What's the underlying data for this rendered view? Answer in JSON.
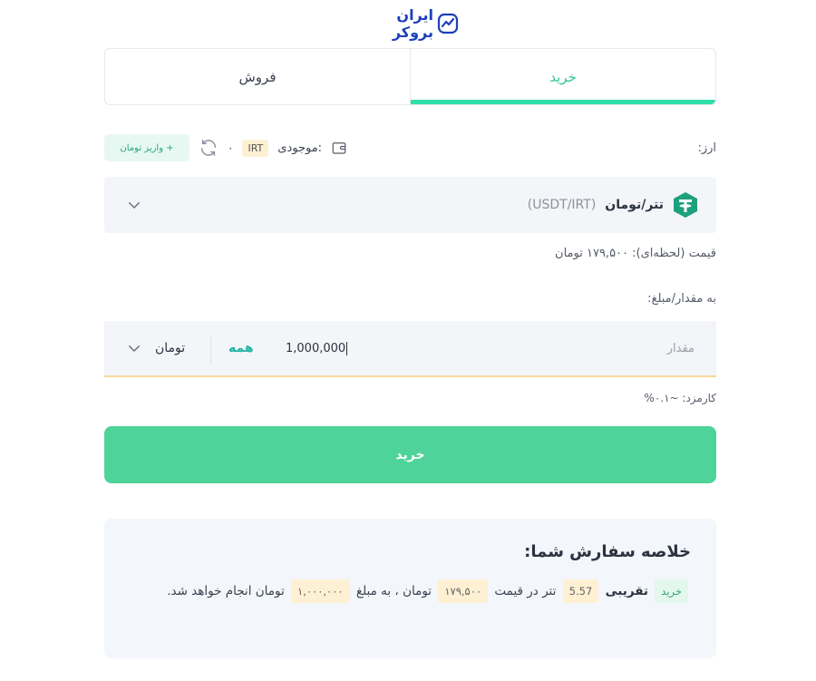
{
  "brand": {
    "logo_text": "ایران بروکر"
  },
  "tabs": [
    {
      "label": "خرید",
      "active": true
    },
    {
      "label": "فروش",
      "active": false
    }
  ],
  "balance": {
    "currency_label": "ارز:",
    "balance_label": "موجودی:",
    "currency_code": "IRT",
    "value": "۰",
    "deposit_button": "+ واریز تومان"
  },
  "pair": {
    "name": "تتر/تومان",
    "code": "(USDT/IRT)"
  },
  "price_line": "قیمت (لحظه‌ای): ۱۷۹,۵۰۰ تومان",
  "amount": {
    "label": "به مقدار/مبلغ:",
    "placeholder": "مقدار",
    "value": "1,000,000",
    "all_button": "همه",
    "unit": "تومان"
  },
  "fee_line": "کارمزد: ~۰.۱%",
  "buy_button": "خرید",
  "summary": {
    "title": "خلاصه سفارش شما:",
    "side_chip": "خرید",
    "approx_word": "تقریبی",
    "qty_chip": "5.57",
    "text_after_qty": "تتر در قیمت",
    "price_chip": "۱۷۹,۵۰۰",
    "text_after_price": "تومان ، به مبلغ",
    "total_chip": "۱,۰۰۰,۰۰۰",
    "text_end": "تومان انجام خواهد شد."
  },
  "colors": {
    "accent": "#2ee0a8",
    "buy_button": "#4ed39a",
    "brand": "#1d3fbb",
    "all_button": "#22b3a3"
  },
  "icons": [
    "brand-chart-icon",
    "wallet-icon",
    "refresh-icon",
    "tether-icon",
    "chevron-down-icon"
  ]
}
